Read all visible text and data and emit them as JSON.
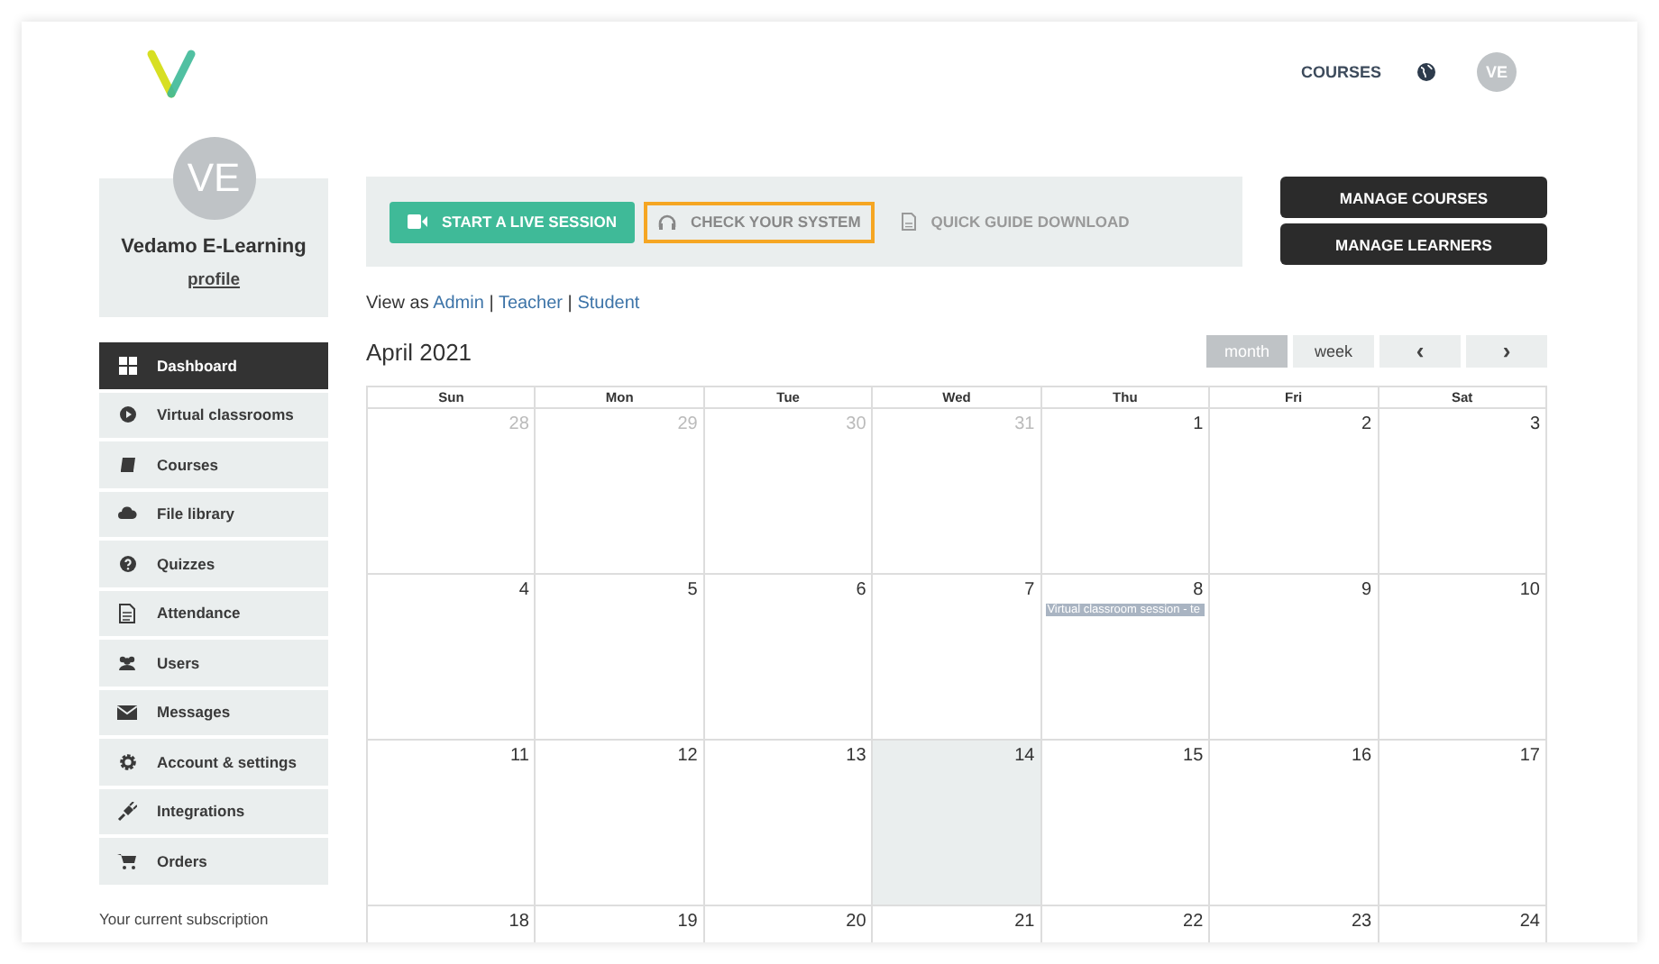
{
  "header": {
    "nav_link": "COURSES",
    "avatar_initials": "VE"
  },
  "profile": {
    "initials": "VE",
    "name": "Vedamo E-Learning",
    "link": "profile"
  },
  "sidebar": {
    "items": [
      {
        "label": "Dashboard",
        "selected": true
      },
      {
        "label": "Virtual classrooms",
        "selected": false
      },
      {
        "label": "Courses",
        "selected": false
      },
      {
        "label": "File library",
        "selected": false
      },
      {
        "label": "Quizzes",
        "selected": false
      },
      {
        "label": "Attendance",
        "selected": false
      },
      {
        "label": "Users",
        "selected": false
      },
      {
        "label": "Messages",
        "selected": false
      },
      {
        "label": "Account & settings",
        "selected": false
      },
      {
        "label": "Integrations",
        "selected": false
      },
      {
        "label": "Orders",
        "selected": false
      }
    ],
    "footer": "Your current subscription"
  },
  "actions": [
    {
      "label": "START A LIVE SESSION",
      "kind": "primary"
    },
    {
      "label": "CHECK YOUR SYSTEM",
      "kind": "outlined"
    },
    {
      "label": "QUICK GUIDE DOWNLOAD",
      "kind": "plain"
    }
  ],
  "manage_buttons": [
    "MANAGE COURSES",
    "MANAGE LEARNERS"
  ],
  "view_as": {
    "prefix": "View as",
    "links": [
      "Admin",
      "Teacher",
      "Student"
    ],
    "separator": "|"
  },
  "calendar": {
    "title": "April 2021",
    "views": [
      {
        "label": "month",
        "selected": true
      },
      {
        "label": "week",
        "selected": false
      }
    ],
    "prev": "‹",
    "next": "›",
    "weekdays": [
      "Sun",
      "Mon",
      "Tue",
      "Wed",
      "Thu",
      "Fri",
      "Sat"
    ],
    "weeks": [
      [
        {
          "day": "28",
          "other_month": true
        },
        {
          "day": "29",
          "other_month": true
        },
        {
          "day": "30",
          "other_month": true
        },
        {
          "day": "31",
          "other_month": true
        },
        {
          "day": "1",
          "other_month": false
        },
        {
          "day": "2",
          "other_month": false
        },
        {
          "day": "3",
          "other_month": false
        }
      ],
      [
        {
          "day": "4",
          "other_month": false
        },
        {
          "day": "5",
          "other_month": false
        },
        {
          "day": "6",
          "other_month": false
        },
        {
          "day": "7",
          "other_month": false
        },
        {
          "day": "8",
          "other_month": false,
          "events": [
            "Virtual classroom session - te"
          ]
        },
        {
          "day": "9",
          "other_month": false
        },
        {
          "day": "10",
          "other_month": false
        }
      ],
      [
        {
          "day": "11",
          "other_month": false
        },
        {
          "day": "12",
          "other_month": false
        },
        {
          "day": "13",
          "other_month": false
        },
        {
          "day": "14",
          "other_month": false,
          "today": true
        },
        {
          "day": "15",
          "other_month": false
        },
        {
          "day": "16",
          "other_month": false
        },
        {
          "day": "17",
          "other_month": false
        }
      ],
      [
        {
          "day": "18",
          "other_month": false
        },
        {
          "day": "19",
          "other_month": false
        },
        {
          "day": "20",
          "other_month": false
        },
        {
          "day": "21",
          "other_month": false
        },
        {
          "day": "22",
          "other_month": false
        },
        {
          "day": "23",
          "other_month": false
        },
        {
          "day": "24",
          "other_month": false
        }
      ]
    ]
  }
}
